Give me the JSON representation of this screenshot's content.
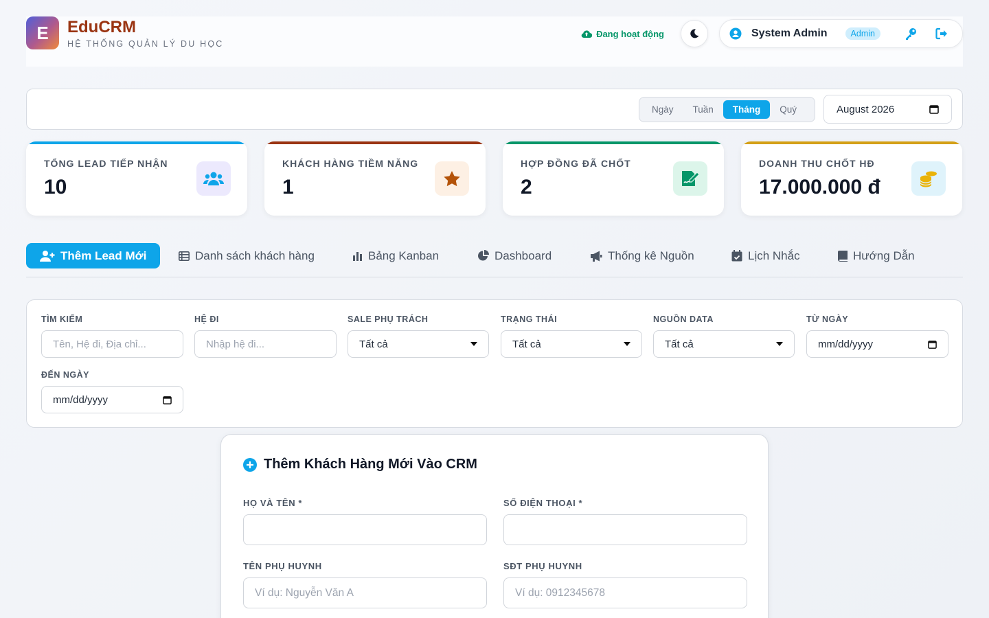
{
  "header": {
    "logo_letter": "E",
    "brand_title": "EduCRM",
    "brand_subtitle": "HỆ THỐNG QUẢN LÝ DU HỌC",
    "status_text": "Đang hoạt động",
    "user_name": "System Admin",
    "user_role": "Admin"
  },
  "period": {
    "options": [
      "Ngày",
      "Tuần",
      "Tháng",
      "Quý"
    ],
    "selected": "Tháng",
    "month_value": "August 2026"
  },
  "stats": [
    {
      "label": "TỔNG LEAD TIẾP NHẬN",
      "value": "10",
      "color": "#0ea5e9",
      "icon": "users-icon"
    },
    {
      "label": "KHÁCH HÀNG TIỀM NĂNG",
      "value": "1",
      "color": "#9a3412",
      "icon": "star-icon"
    },
    {
      "label": "HỢP ĐỒNG ĐÃ CHỐT",
      "value": "2",
      "color": "#059669",
      "icon": "contract-signature-icon"
    },
    {
      "label": "DOANH THU CHỐT HĐ",
      "value": "17.000.000 đ",
      "color": "#d4a017",
      "icon": "coins-icon"
    }
  ],
  "tabs": [
    {
      "label": "Thêm Lead Mới",
      "icon": "user-plus-icon",
      "active": true
    },
    {
      "label": "Danh sách khách hàng",
      "icon": "table-list-icon"
    },
    {
      "label": "Bảng Kanban",
      "icon": "bar-chart-icon"
    },
    {
      "label": "Dashboard",
      "icon": "pie-chart-icon"
    },
    {
      "label": "Thống kê Nguồn",
      "icon": "bullhorn-icon"
    },
    {
      "label": "Lịch Nhắc",
      "icon": "calendar-check-icon"
    },
    {
      "label": "Hướng Dẫn",
      "icon": "book-icon"
    }
  ],
  "filters": {
    "search_label": "TÌM KIẾM",
    "search_placeholder": "Tên, Hệ đi, Địa chỉ...",
    "system_label": "HỆ ĐI",
    "system_placeholder": "Nhập hệ đi...",
    "sale_label": "SALE PHỤ TRÁCH",
    "sale_value": "Tất cả",
    "status_label": "TRẠNG THÁI",
    "status_value": "Tất cả",
    "source_label": "NGUỒN DATA",
    "source_value": "Tất cả",
    "from_label": "TỪ NGÀY",
    "from_value": "mm/dd/yyyy",
    "to_label": "ĐẾN NGÀY",
    "to_value": "mm/dd/yyyy"
  },
  "form": {
    "title": "Thêm Khách Hàng Mới Vào CRM",
    "name_label": "HỌ VÀ TÊN *",
    "phone_label": "SỐ ĐIỆN THOẠI *",
    "parent_name_label": "TÊN PHỤ HUYNH",
    "parent_name_placeholder": "Ví dụ: Nguyễn Văn A",
    "parent_phone_label": "SĐT PHỤ HUYNH",
    "parent_phone_placeholder": "Ví dụ: 0912345678"
  }
}
